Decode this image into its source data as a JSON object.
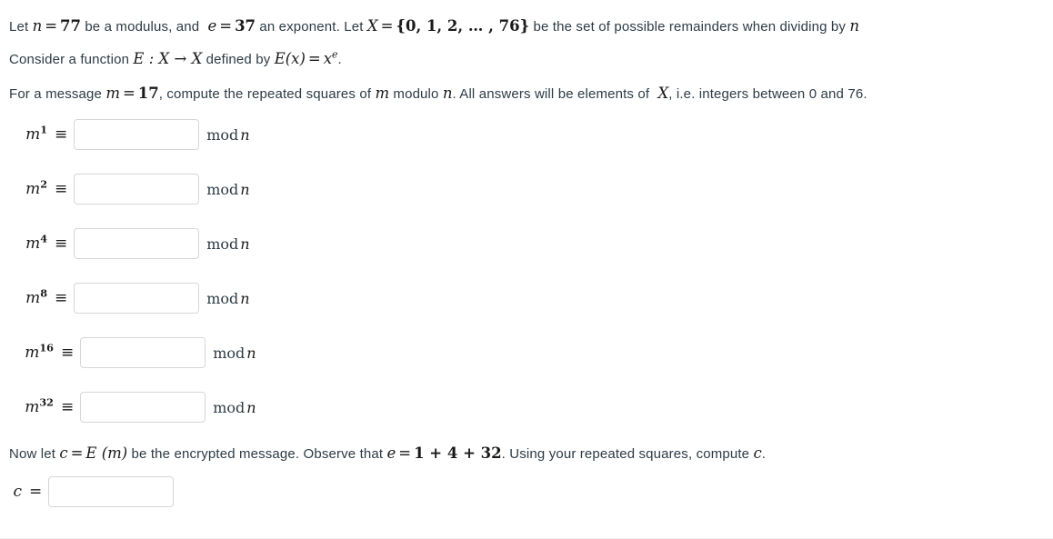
{
  "problem": {
    "line1": {
      "t1": "Let ",
      "m1_var": "n",
      "m1_eq": "=",
      "m1_val": "77",
      "t2": " be a modulus, and ",
      "m2_var": "e",
      "m2_eq": "=",
      "m2_val": "37",
      "t3": " an exponent. Let ",
      "m3_var": "X",
      "m3_eq": "=",
      "m3_set": "{0, 1, 2, … , 76}",
      "t4": " be the set of possible remainders when dividing by ",
      "m4_var": "n"
    },
    "line2": {
      "t1": "Consider a function ",
      "m1": "E : X → X",
      "t2": " defined by ",
      "m2_fn": "E(x)",
      "m2_eq": "=",
      "m2_rhs_base": "x",
      "m2_rhs_exp": "e",
      "t3": "."
    },
    "line3": {
      "t1": "For a message ",
      "m1_var": "m",
      "m1_eq": "=",
      "m1_val": "17",
      "t2": ", compute the repeated squares of ",
      "m2_var": "m",
      "t3": " modulo ",
      "m3_var": "n",
      "t4": ". All answers will be elements of ",
      "m4_var": "X",
      "t5": ", i.e. integers between 0 and 76."
    },
    "line4": {
      "t1": "Now let ",
      "m1_var": "c",
      "m1_eq": "=",
      "m1_fn": "E (m)",
      "t2": " be the encrypted message. Observe that ",
      "m2_var": "e",
      "m2_eq": "=",
      "m2_expr": "1 + 4 + 32",
      "t3": ". Using your repeated squares, compute ",
      "m3_var": "c",
      "t4": "."
    }
  },
  "squares": {
    "relation_symbol": "≡",
    "mod_keyword": "mod",
    "mod_variable": "n",
    "base": "m",
    "rows": [
      {
        "exponent": "1",
        "value": "",
        "placeholder": ""
      },
      {
        "exponent": "2",
        "value": "",
        "placeholder": ""
      },
      {
        "exponent": "4",
        "value": "",
        "placeholder": ""
      },
      {
        "exponent": "8",
        "value": "",
        "placeholder": ""
      },
      {
        "exponent": "16",
        "value": "",
        "placeholder": ""
      },
      {
        "exponent": "32",
        "value": "",
        "placeholder": ""
      }
    ]
  },
  "final": {
    "variable": "c",
    "relation_symbol": "=",
    "value": "",
    "placeholder": ""
  },
  "colors": {
    "prose_text": "#2d3b45",
    "math_text": "#1a1a1a",
    "input_border": "#d6d6d6",
    "page_background": "#ffffff",
    "divider": "#f0f0f0"
  }
}
